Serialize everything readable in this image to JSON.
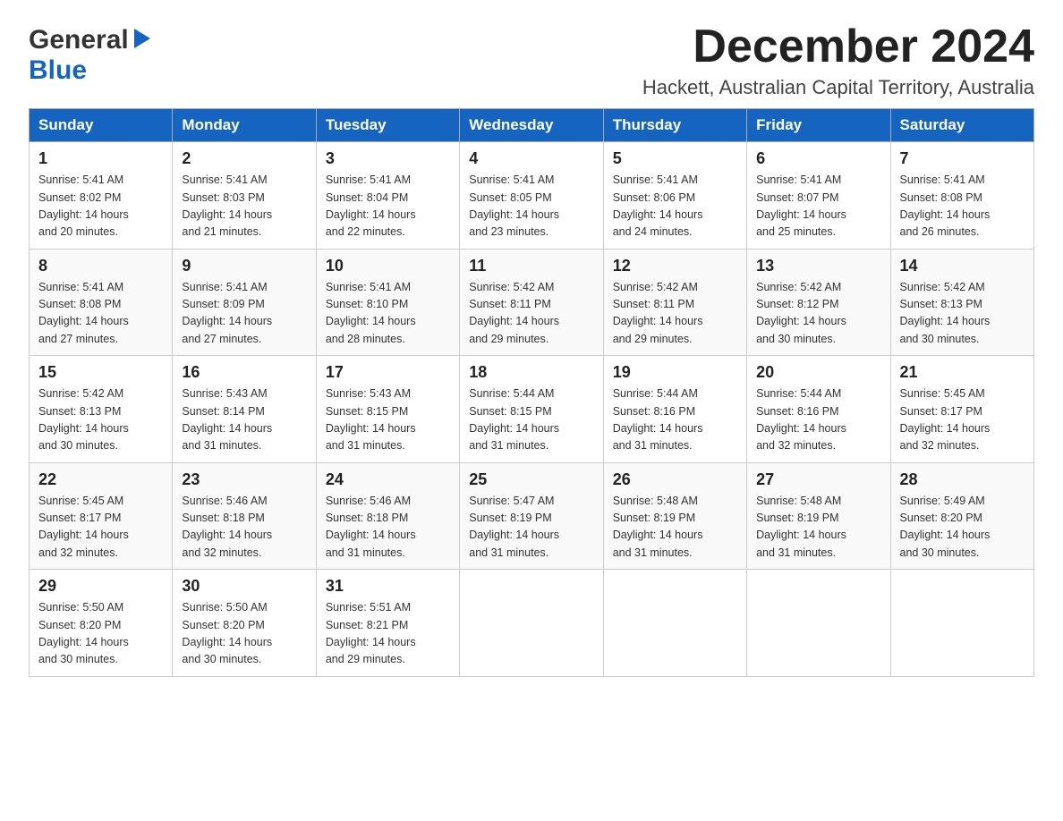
{
  "logo": {
    "word1": "General",
    "word2": "Blue"
  },
  "title": {
    "month": "December 2024",
    "location": "Hackett, Australian Capital Territory, Australia"
  },
  "headers": [
    "Sunday",
    "Monday",
    "Tuesday",
    "Wednesday",
    "Thursday",
    "Friday",
    "Saturday"
  ],
  "weeks": [
    [
      {
        "day": "1",
        "sunrise": "5:41 AM",
        "sunset": "8:02 PM",
        "daylight": "14 hours and 20 minutes."
      },
      {
        "day": "2",
        "sunrise": "5:41 AM",
        "sunset": "8:03 PM",
        "daylight": "14 hours and 21 minutes."
      },
      {
        "day": "3",
        "sunrise": "5:41 AM",
        "sunset": "8:04 PM",
        "daylight": "14 hours and 22 minutes."
      },
      {
        "day": "4",
        "sunrise": "5:41 AM",
        "sunset": "8:05 PM",
        "daylight": "14 hours and 23 minutes."
      },
      {
        "day": "5",
        "sunrise": "5:41 AM",
        "sunset": "8:06 PM",
        "daylight": "14 hours and 24 minutes."
      },
      {
        "day": "6",
        "sunrise": "5:41 AM",
        "sunset": "8:07 PM",
        "daylight": "14 hours and 25 minutes."
      },
      {
        "day": "7",
        "sunrise": "5:41 AM",
        "sunset": "8:08 PM",
        "daylight": "14 hours and 26 minutes."
      }
    ],
    [
      {
        "day": "8",
        "sunrise": "5:41 AM",
        "sunset": "8:08 PM",
        "daylight": "14 hours and 27 minutes."
      },
      {
        "day": "9",
        "sunrise": "5:41 AM",
        "sunset": "8:09 PM",
        "daylight": "14 hours and 27 minutes."
      },
      {
        "day": "10",
        "sunrise": "5:41 AM",
        "sunset": "8:10 PM",
        "daylight": "14 hours and 28 minutes."
      },
      {
        "day": "11",
        "sunrise": "5:42 AM",
        "sunset": "8:11 PM",
        "daylight": "14 hours and 29 minutes."
      },
      {
        "day": "12",
        "sunrise": "5:42 AM",
        "sunset": "8:11 PM",
        "daylight": "14 hours and 29 minutes."
      },
      {
        "day": "13",
        "sunrise": "5:42 AM",
        "sunset": "8:12 PM",
        "daylight": "14 hours and 30 minutes."
      },
      {
        "day": "14",
        "sunrise": "5:42 AM",
        "sunset": "8:13 PM",
        "daylight": "14 hours and 30 minutes."
      }
    ],
    [
      {
        "day": "15",
        "sunrise": "5:42 AM",
        "sunset": "8:13 PM",
        "daylight": "14 hours and 30 minutes."
      },
      {
        "day": "16",
        "sunrise": "5:43 AM",
        "sunset": "8:14 PM",
        "daylight": "14 hours and 31 minutes."
      },
      {
        "day": "17",
        "sunrise": "5:43 AM",
        "sunset": "8:15 PM",
        "daylight": "14 hours and 31 minutes."
      },
      {
        "day": "18",
        "sunrise": "5:44 AM",
        "sunset": "8:15 PM",
        "daylight": "14 hours and 31 minutes."
      },
      {
        "day": "19",
        "sunrise": "5:44 AM",
        "sunset": "8:16 PM",
        "daylight": "14 hours and 31 minutes."
      },
      {
        "day": "20",
        "sunrise": "5:44 AM",
        "sunset": "8:16 PM",
        "daylight": "14 hours and 32 minutes."
      },
      {
        "day": "21",
        "sunrise": "5:45 AM",
        "sunset": "8:17 PM",
        "daylight": "14 hours and 32 minutes."
      }
    ],
    [
      {
        "day": "22",
        "sunrise": "5:45 AM",
        "sunset": "8:17 PM",
        "daylight": "14 hours and 32 minutes."
      },
      {
        "day": "23",
        "sunrise": "5:46 AM",
        "sunset": "8:18 PM",
        "daylight": "14 hours and 32 minutes."
      },
      {
        "day": "24",
        "sunrise": "5:46 AM",
        "sunset": "8:18 PM",
        "daylight": "14 hours and 31 minutes."
      },
      {
        "day": "25",
        "sunrise": "5:47 AM",
        "sunset": "8:19 PM",
        "daylight": "14 hours and 31 minutes."
      },
      {
        "day": "26",
        "sunrise": "5:48 AM",
        "sunset": "8:19 PM",
        "daylight": "14 hours and 31 minutes."
      },
      {
        "day": "27",
        "sunrise": "5:48 AM",
        "sunset": "8:19 PM",
        "daylight": "14 hours and 31 minutes."
      },
      {
        "day": "28",
        "sunrise": "5:49 AM",
        "sunset": "8:20 PM",
        "daylight": "14 hours and 30 minutes."
      }
    ],
    [
      {
        "day": "29",
        "sunrise": "5:50 AM",
        "sunset": "8:20 PM",
        "daylight": "14 hours and 30 minutes."
      },
      {
        "day": "30",
        "sunrise": "5:50 AM",
        "sunset": "8:20 PM",
        "daylight": "14 hours and 30 minutes."
      },
      {
        "day": "31",
        "sunrise": "5:51 AM",
        "sunset": "8:21 PM",
        "daylight": "14 hours and 29 minutes."
      },
      null,
      null,
      null,
      null
    ]
  ],
  "labels": {
    "sunrise": "Sunrise:",
    "sunset": "Sunset:",
    "daylight": "Daylight:"
  }
}
